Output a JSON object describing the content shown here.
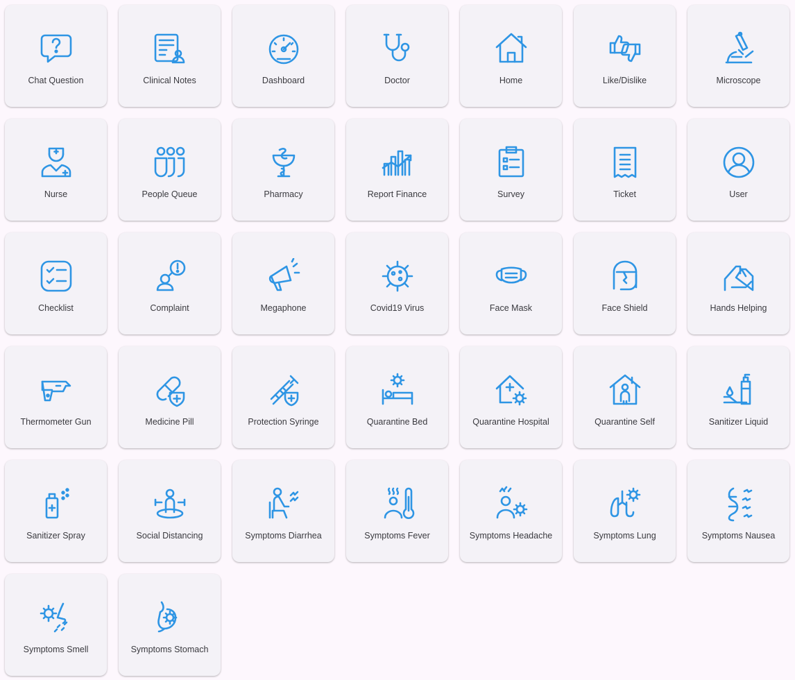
{
  "accent_color": "#2e95e4",
  "tiles": [
    {
      "label": "Chat Question",
      "icon": "chat-question"
    },
    {
      "label": "Clinical Notes",
      "icon": "clinical-notes"
    },
    {
      "label": "Dashboard",
      "icon": "dashboard"
    },
    {
      "label": "Doctor",
      "icon": "doctor"
    },
    {
      "label": "Home",
      "icon": "home"
    },
    {
      "label": "Like/Dislike",
      "icon": "like-dislike"
    },
    {
      "label": "Microscope",
      "icon": "microscope"
    },
    {
      "label": "Nurse",
      "icon": "nurse"
    },
    {
      "label": "People Queue",
      "icon": "people-queue"
    },
    {
      "label": "Pharmacy",
      "icon": "pharmacy"
    },
    {
      "label": "Report Finance",
      "icon": "report-finance"
    },
    {
      "label": "Survey",
      "icon": "survey"
    },
    {
      "label": "Ticket",
      "icon": "ticket"
    },
    {
      "label": "User",
      "icon": "user"
    },
    {
      "label": "Checklist",
      "icon": "checklist"
    },
    {
      "label": "Complaint",
      "icon": "complaint"
    },
    {
      "label": "Megaphone",
      "icon": "megaphone"
    },
    {
      "label": "Covid19 Virus",
      "icon": "covid19-virus"
    },
    {
      "label": "Face Mask",
      "icon": "face-mask"
    },
    {
      "label": "Face Shield",
      "icon": "face-shield"
    },
    {
      "label": "Hands Helping",
      "icon": "hands-helping"
    },
    {
      "label": "Thermometer Gun",
      "icon": "thermometer-gun"
    },
    {
      "label": "Medicine Pill",
      "icon": "medicine-pill"
    },
    {
      "label": "Protection Syringe",
      "icon": "protection-syringe"
    },
    {
      "label": "Quarantine Bed",
      "icon": "quarantine-bed"
    },
    {
      "label": "Quarantine Hospital",
      "icon": "quarantine-hospital"
    },
    {
      "label": "Quarantine Self",
      "icon": "quarantine-self"
    },
    {
      "label": "Sanitizer Liquid",
      "icon": "sanitizer-liquid"
    },
    {
      "label": "Sanitizer Spray",
      "icon": "sanitizer-spray"
    },
    {
      "label": "Social Distancing",
      "icon": "social-distancing"
    },
    {
      "label": "Symptoms Diarrhea",
      "icon": "symptoms-diarrhea"
    },
    {
      "label": "Symptoms Fever",
      "icon": "symptoms-fever"
    },
    {
      "label": "Symptoms Headache",
      "icon": "symptoms-headache"
    },
    {
      "label": "Symptoms Lung",
      "icon": "symptoms-lung"
    },
    {
      "label": "Symptoms Nausea",
      "icon": "symptoms-nausea"
    },
    {
      "label": "Symptoms Smell",
      "icon": "symptoms-smell"
    },
    {
      "label": "Symptoms Stomach",
      "icon": "symptoms-stomach"
    }
  ]
}
